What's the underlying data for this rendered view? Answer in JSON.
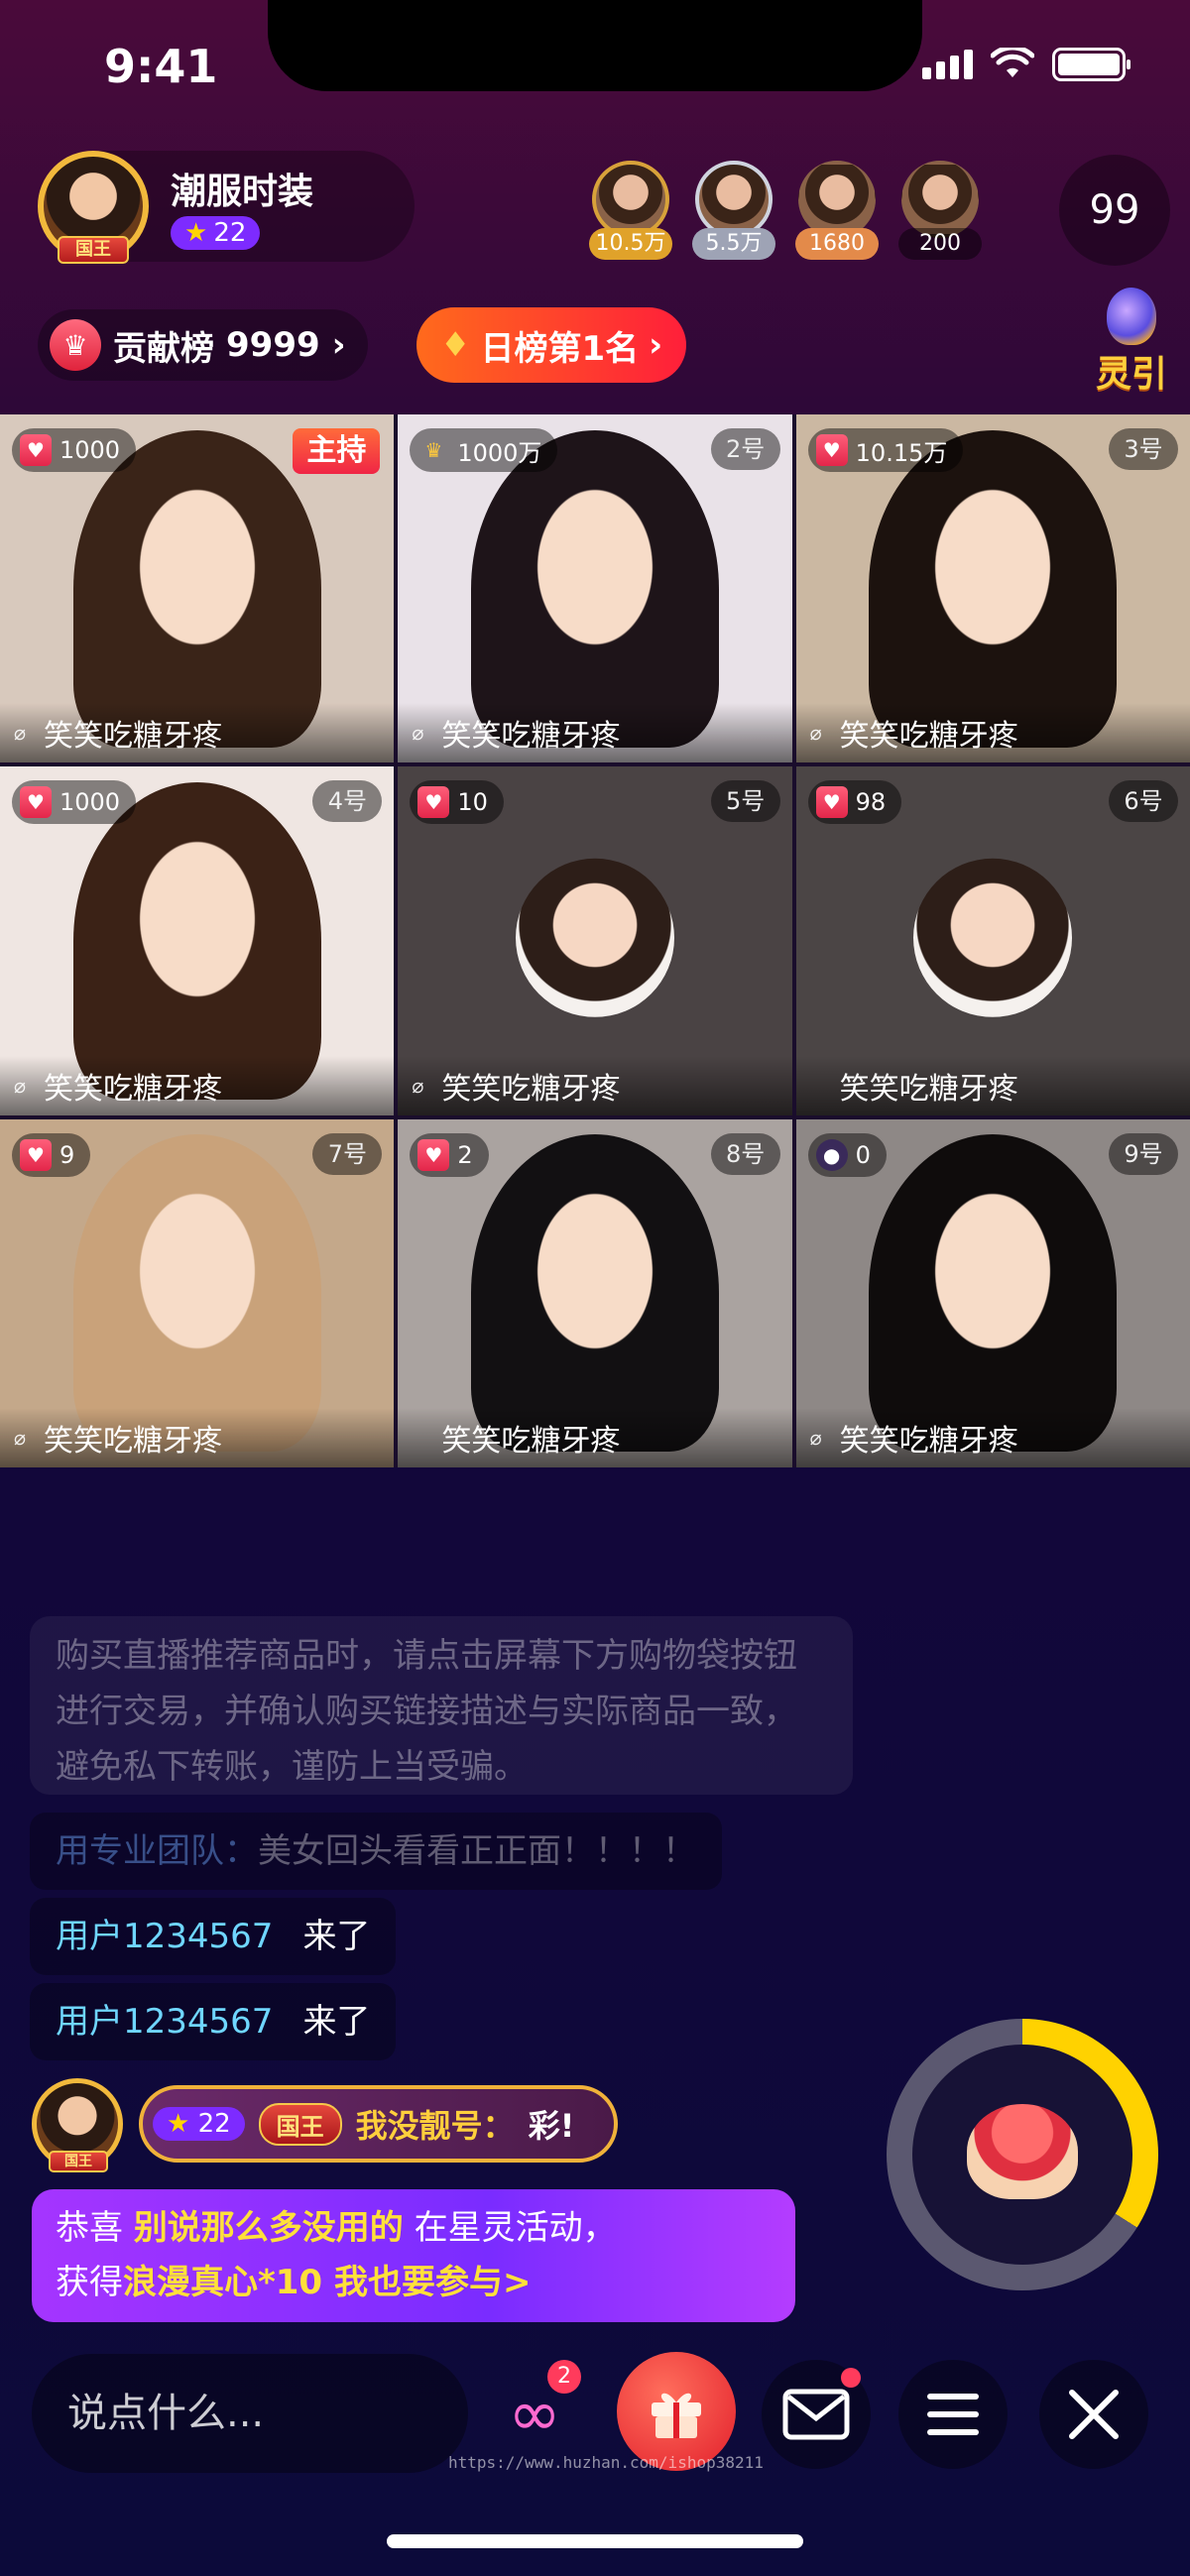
{
  "status_bar": {
    "time": "9:41"
  },
  "host": {
    "name": "潮服时装",
    "level": "22",
    "title_badge": "国王"
  },
  "viewers": [
    {
      "score": "10.5万",
      "color": "#e0a22a"
    },
    {
      "score": "5.5万",
      "color": "#9ea3b5"
    },
    {
      "score": "1680",
      "color": "#e38a4a"
    },
    {
      "score": "200",
      "color": "rgba(0,0,0,0.45)"
    }
  ],
  "viewer_count": "99",
  "contribution": {
    "label": "贡献榜",
    "value": "9999",
    "arrow": "›"
  },
  "daily_rank": {
    "label": "日榜第1名",
    "arrow": "›"
  },
  "lingyin_label": "灵引",
  "seats": [
    {
      "gift": "1000",
      "tag": "主持",
      "name": "笑笑吃糖牙疼",
      "mic": true,
      "host": true,
      "gift_icon": "gift",
      "bg": "#d8c9bd",
      "hair": "#3a2418",
      "type": "photo"
    },
    {
      "gift": "1000万",
      "tag": "2号",
      "name": "笑笑吃糖牙疼",
      "mic": true,
      "host": false,
      "gift_icon": "crown",
      "bg": "#e9e2e8",
      "hair": "#1e1419",
      "type": "photo"
    },
    {
      "gift": "10.15万",
      "tag": "3号",
      "name": "笑笑吃糖牙疼",
      "mic": true,
      "host": false,
      "gift_icon": "gift",
      "bg": "#cbb8a2",
      "hair": "#1c120e",
      "type": "photo"
    },
    {
      "gift": "1000",
      "tag": "4号",
      "name": "笑笑吃糖牙疼",
      "mic": true,
      "host": false,
      "gift_icon": "gift",
      "bg": "#efe6e2",
      "hair": "#3b2216",
      "type": "photo"
    },
    {
      "gift": "10",
      "tag": "5号",
      "name": "笑笑吃糖牙疼",
      "mic": true,
      "host": false,
      "gift_icon": "gift",
      "bg": "#4a4344",
      "hair": "",
      "type": "avatar"
    },
    {
      "gift": "98",
      "tag": "6号",
      "name": "笑笑吃糖牙疼",
      "mic": false,
      "host": false,
      "gift_icon": "gift",
      "bg": "#4b4545",
      "hair": "",
      "type": "avatar"
    },
    {
      "gift": "9",
      "tag": "7号",
      "name": "笑笑吃糖牙疼",
      "mic": true,
      "host": false,
      "gift_icon": "gift",
      "bg": "#c4a88a",
      "hair": "#c9a27a",
      "type": "photo"
    },
    {
      "gift": "2",
      "tag": "8号",
      "name": "笑笑吃糖牙疼",
      "mic": false,
      "host": false,
      "gift_icon": "gift",
      "bg": "#aaa3a0",
      "hair": "#121012",
      "type": "photo"
    },
    {
      "gift": "0",
      "tag": "9号",
      "name": "笑笑吃糖牙疼",
      "mic": true,
      "host": false,
      "gift_icon": "bomb",
      "bg": "#8e8886",
      "hair": "#0f0c0c",
      "type": "photo"
    }
  ],
  "chat": {
    "notice": "购买直播推荐商品时，请点击屏幕下方购物袋按钮进行交易，并确认购买链接描述与实际商品一致，避免私下转账，谨防上当受骗。",
    "pro_team": {
      "who": "用专业团队：",
      "text": "美女回头看看正正面！！！！"
    },
    "joins": [
      {
        "who": "用户1234567",
        "text": "来了"
      },
      {
        "who": "用户1234567",
        "text": "来了"
      }
    ],
    "vip": {
      "level": "22",
      "badge": "国王",
      "nick": "我没靓号：",
      "text": "彩!",
      "avatar_badge": "国王"
    },
    "congrats": {
      "prefix": "恭喜 ",
      "user": "别说那么多没用的",
      "mid": " 在星灵活动，",
      "line2_prefix": "获得",
      "reward": "浪漫真心*10",
      "cta": " 我也要参与>"
    }
  },
  "lucky_progress": 0.34,
  "bottom_bar": {
    "input_placeholder": "说点什么...",
    "link_badge": "2",
    "watermark": "https://www.huzhan.com/ishop38211"
  }
}
